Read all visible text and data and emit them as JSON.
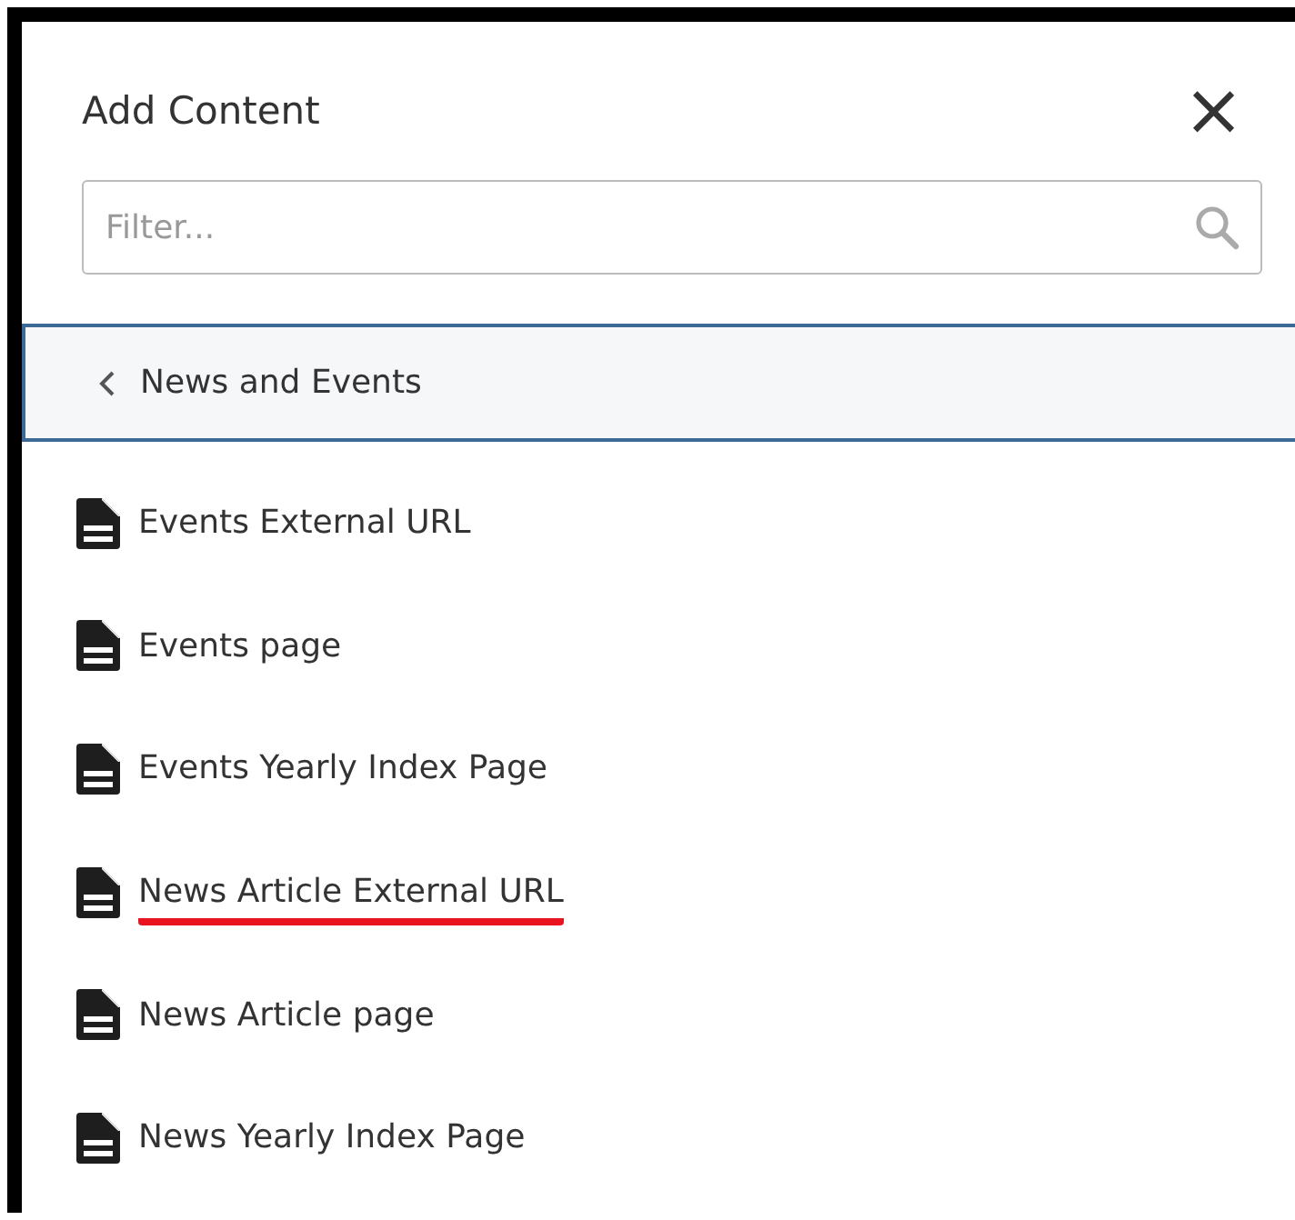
{
  "panel": {
    "title": "Add Content",
    "close_icon": "×"
  },
  "filter": {
    "placeholder": "Filter..."
  },
  "breadcrumb": {
    "label": "News and Events"
  },
  "items": [
    {
      "label": "Events External URL",
      "underlined": false
    },
    {
      "label": "Events page",
      "underlined": false
    },
    {
      "label": "Events Yearly Index Page",
      "underlined": false
    },
    {
      "label": "News Article External URL",
      "underlined": true
    },
    {
      "label": "News Article page",
      "underlined": false
    },
    {
      "label": "News Yearly Index Page",
      "underlined": false
    }
  ]
}
